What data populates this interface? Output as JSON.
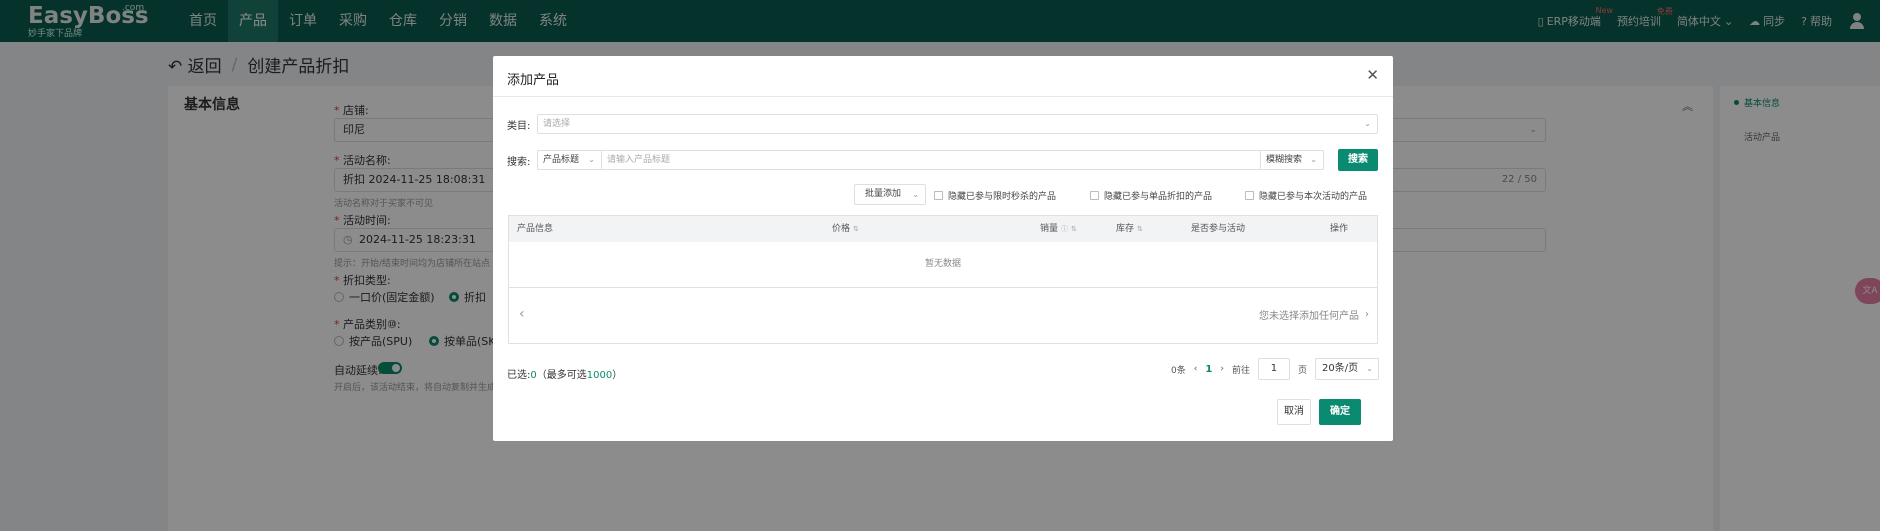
{
  "nav": {
    "brand": "EasyBoss",
    "brand_suffix": ".com",
    "slogan": "妙手家下品牌",
    "menu": [
      "首页",
      "产品",
      "订单",
      "采购",
      "仓库",
      "分销",
      "数据",
      "系统"
    ],
    "right": {
      "mobile": "ERP移动端",
      "mobile_tag": "New",
      "training": "预约培训",
      "training_tag": "免费",
      "language": "简体中文",
      "sync": "同步",
      "help": "帮助"
    }
  },
  "page": {
    "back": "返回",
    "title": "创建产品折扣",
    "section_title": "基本信息",
    "store_label": "店铺:",
    "store_value": "印尼",
    "activity_name_label": "活动名称:",
    "activity_name_value": "折扣 2024-11-25 18:08:31",
    "activity_name_count": "22 / 50",
    "activity_name_hint": "活动名称对于买家不可见",
    "activity_time_label": "活动时间:",
    "activity_time_value": "2024-11-25 18:23:31",
    "activity_time_hint": "提示：开始/结束时间均为店铺所在站点",
    "discount_type_label": "折扣类型:",
    "discount_type_options": [
      "一口价(固定金额)",
      "折扣"
    ],
    "product_type_label": "产品类别⑩:",
    "product_type_options": [
      "按产品(SPU)",
      "按单品(SKU"
    ],
    "auto_renew_label": "自动延续:",
    "auto_renew_hint": "开启后，该活动结束，将自动复制并生成新的活动",
    "anchors": [
      "基本信息",
      "活动产品"
    ]
  },
  "float_button": "文A",
  "modal": {
    "title": "添加产品",
    "category_label": "类目:",
    "category_placeholder": "请选择",
    "search_label": "搜索:",
    "search_field": "产品标题",
    "search_placeholder": "请输入产品标题",
    "search_mode": "模糊搜索",
    "search_button": "搜索",
    "bulk_add": "批量添加",
    "filters": [
      "隐藏已参与限时秒杀的产品",
      "隐藏已参与单品折扣的产品",
      "隐藏已参与本次活动的产品"
    ],
    "columns": [
      "产品信息",
      "价格",
      "销量",
      "库存",
      "是否参与活动",
      "操作"
    ],
    "empty_text": "暂无数据",
    "no_selection_text": "您未选择添加任何产品",
    "selected_prefix": "已选:",
    "selected_count": "0",
    "max_prefix": "（最多可选",
    "max_count": "1000",
    "max_suffix": "）",
    "total": "0条",
    "current_page": "1",
    "goto_label": "前往",
    "goto_value": "1",
    "page_unit": "页",
    "page_size": "20条/页",
    "cancel": "取消",
    "confirm": "确定"
  }
}
